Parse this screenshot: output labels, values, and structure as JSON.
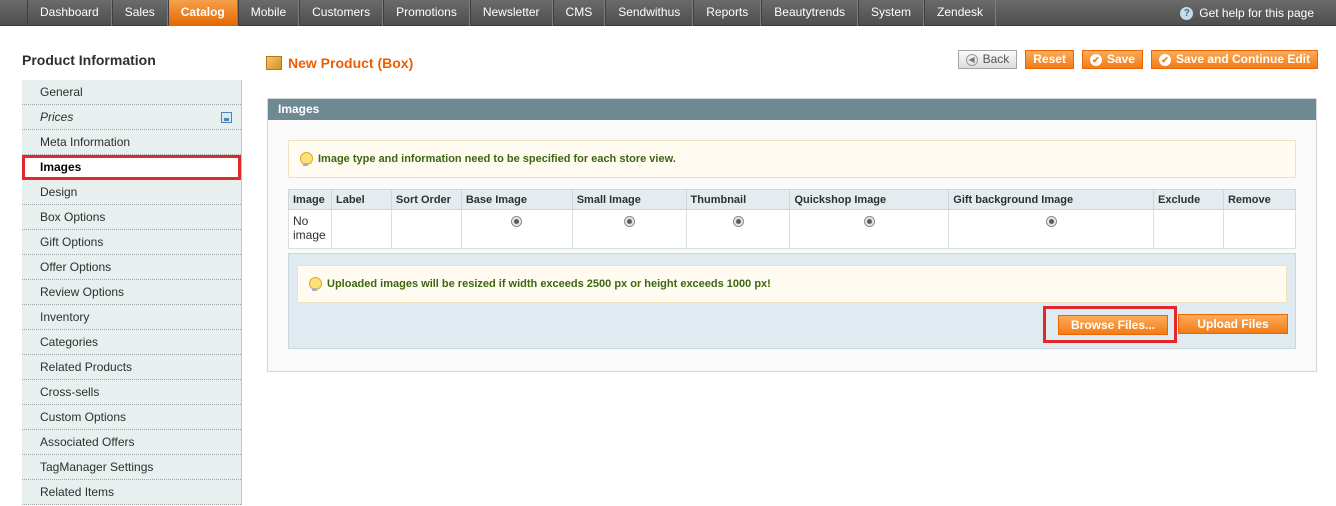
{
  "topnav": {
    "items": [
      {
        "label": "Dashboard"
      },
      {
        "label": "Sales"
      },
      {
        "label": "Catalog",
        "active": true
      },
      {
        "label": "Mobile"
      },
      {
        "label": "Customers"
      },
      {
        "label": "Promotions"
      },
      {
        "label": "Newsletter"
      },
      {
        "label": "CMS"
      },
      {
        "label": "Sendwithus"
      },
      {
        "label": "Reports"
      },
      {
        "label": "Beautytrends"
      },
      {
        "label": "System"
      },
      {
        "label": "Zendesk"
      }
    ],
    "help_label": "Get help for this page",
    "help_icon": "?"
  },
  "sidebar": {
    "title": "Product Information",
    "items": [
      {
        "label": "General"
      },
      {
        "label": "Prices"
      },
      {
        "label": "Meta Information"
      },
      {
        "label": "Images"
      },
      {
        "label": "Design"
      },
      {
        "label": "Box Options"
      },
      {
        "label": "Gift Options"
      },
      {
        "label": "Offer Options"
      },
      {
        "label": "Review Options"
      },
      {
        "label": "Inventory"
      },
      {
        "label": "Categories"
      },
      {
        "label": "Related Products"
      },
      {
        "label": "Cross-sells"
      },
      {
        "label": "Custom Options"
      },
      {
        "label": "Associated Offers"
      },
      {
        "label": "TagManager Settings"
      },
      {
        "label": "Related Items"
      }
    ],
    "active_index": 3
  },
  "header": {
    "title": "New Product (Box)",
    "buttons": {
      "back": "Back",
      "reset": "Reset",
      "save": "Save",
      "save_continue": "Save and Continue Edit"
    }
  },
  "images_section": {
    "title": "Images",
    "store_view_notice": "Image type and information need to be specified for each store view.",
    "columns": [
      "Image",
      "Label",
      "Sort Order",
      "Base Image",
      "Small Image",
      "Thumbnail",
      "Quickshop Image",
      "Gift background Image",
      "Exclude",
      "Remove"
    ],
    "empty_row_text": "No image",
    "resize_notice": "Uploaded images will be resized if width exceeds 2500 px or height exceeds 1000 px!",
    "browse_label": "Browse Files...",
    "upload_label": "Upload Files"
  },
  "colors": {
    "accent": "#eb5e00",
    "nav_active": "#f07c17",
    "highlight": "#e0282d",
    "section_header": "#6f8992"
  }
}
